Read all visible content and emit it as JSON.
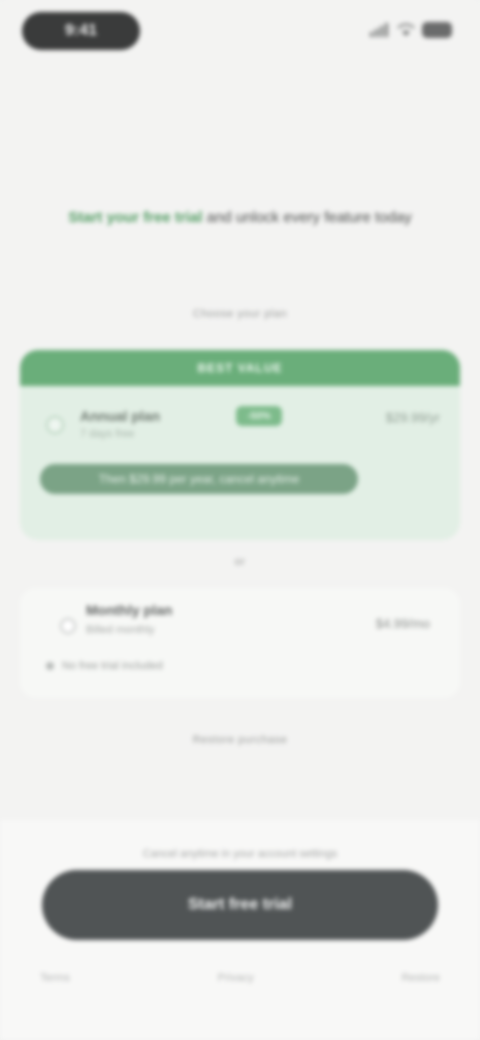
{
  "status_bar": {
    "time": "9:41"
  },
  "headline": {
    "accent": "Start your free trial",
    "text": "and unlock every feature today"
  },
  "labels": {
    "choose_plan": "Choose your plan",
    "or": "or",
    "restore": "Restore purchase"
  },
  "recommended_plan": {
    "banner": "BEST VALUE",
    "name": "Annual plan",
    "badge": "-50%",
    "subtitle": "7 days free",
    "price": "$29.99/yr",
    "note": "Then $29.99 per year, cancel anytime",
    "selected": true
  },
  "alternate_plan": {
    "name": "Monthly plan",
    "subtitle": "Billed monthly",
    "price": "$4.99/mo",
    "detail": "No free trial included",
    "selected": false
  },
  "bottom": {
    "terms": "Cancel anytime in your account settings",
    "cta_label": "Start free trial",
    "links": [
      "Terms",
      "Privacy",
      "Restore"
    ]
  },
  "colors": {
    "accent_green": "#6aae7a",
    "card_green": "#e2efe5",
    "cta_dark": "#505455",
    "background": "#f3f3f2"
  }
}
